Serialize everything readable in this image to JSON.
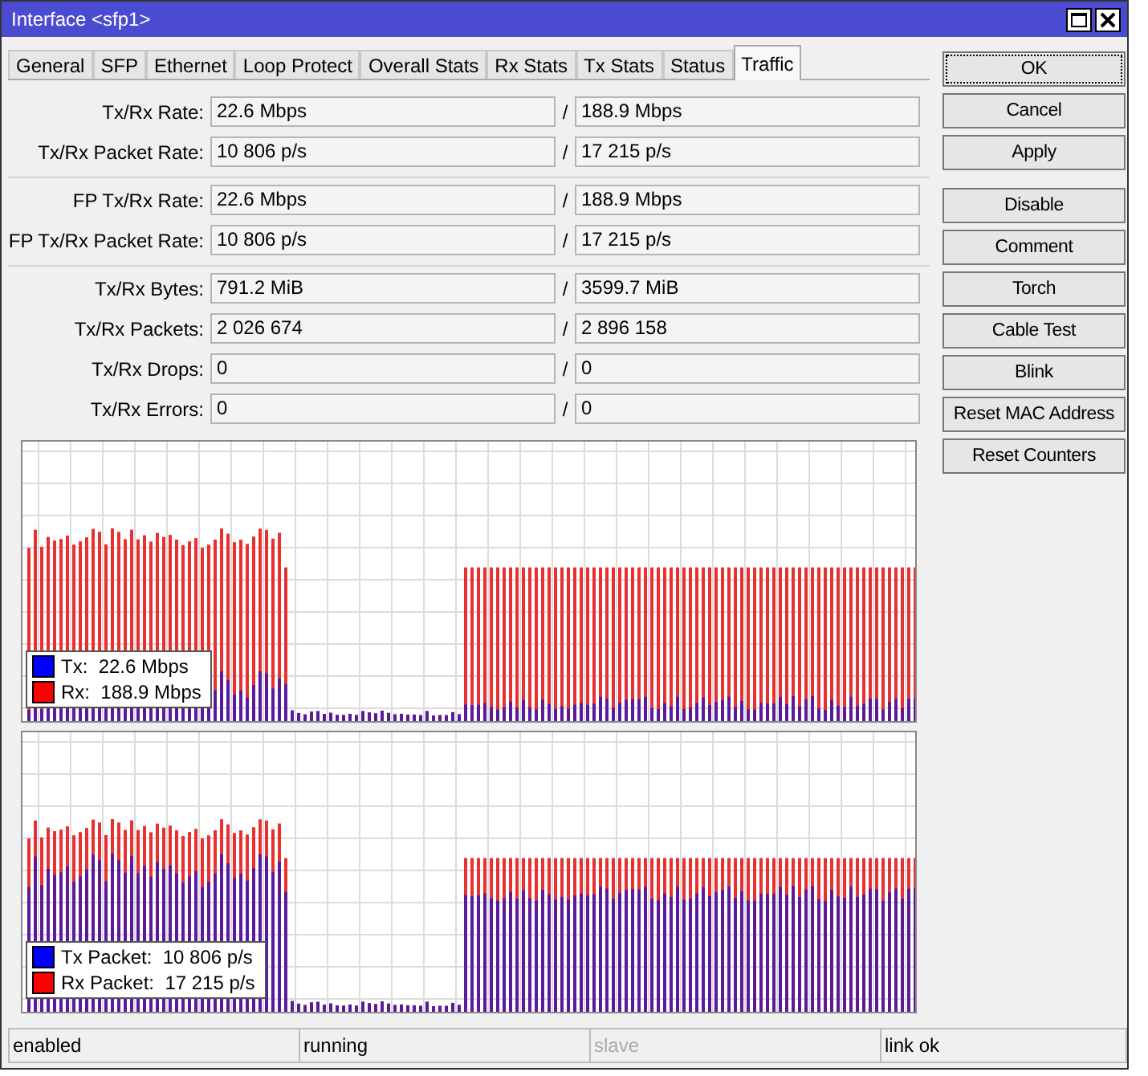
{
  "window": {
    "title": "Interface <sfp1>"
  },
  "tabs": [
    {
      "label": "General",
      "selected": false
    },
    {
      "label": "SFP",
      "selected": false
    },
    {
      "label": "Ethernet",
      "selected": false
    },
    {
      "label": "Loop Protect",
      "selected": false
    },
    {
      "label": "Overall Stats",
      "selected": false
    },
    {
      "label": "Rx Stats",
      "selected": false
    },
    {
      "label": "Tx Stats",
      "selected": false
    },
    {
      "label": "Status",
      "selected": false
    },
    {
      "label": "Traffic",
      "selected": true
    }
  ],
  "field_groups": [
    [
      {
        "label": "Tx/Rx Rate:",
        "tx": "22.6 Mbps",
        "separator": "/",
        "rx": "188.9 Mbps"
      },
      {
        "label": "Tx/Rx Packet Rate:",
        "tx": "10 806 p/s",
        "separator": "/",
        "rx": "17 215 p/s"
      }
    ],
    [
      {
        "label": "FP Tx/Rx Rate:",
        "tx": "22.6 Mbps",
        "separator": "/",
        "rx": "188.9 Mbps"
      },
      {
        "label": "FP Tx/Rx Packet Rate:",
        "tx": "10 806 p/s",
        "separator": "/",
        "rx": "17 215 p/s"
      }
    ],
    [
      {
        "label": "Tx/Rx Bytes:",
        "tx": "791.2 MiB",
        "separator": "/",
        "rx": "3599.7 MiB"
      },
      {
        "label": "Tx/Rx Packets:",
        "tx": "2 026 674",
        "separator": "/",
        "rx": "2 896 158"
      },
      {
        "label": "Tx/Rx Drops:",
        "tx": "0",
        "separator": "/",
        "rx": "0"
      },
      {
        "label": "Tx/Rx Errors:",
        "tx": "0",
        "separator": "/",
        "rx": "0"
      }
    ]
  ],
  "graphs": [
    {
      "legend": [
        {
          "label": "Tx:  22.6 Mbps",
          "color": "#0000ff"
        },
        {
          "label": "Rx:  188.9 Mbps",
          "color": "#ff0000"
        }
      ]
    },
    {
      "legend": [
        {
          "label": "Tx Packet:  10 806 p/s",
          "color": "#0000ff"
        },
        {
          "label": "Rx Packet:  17 215 p/s",
          "color": "#ff0000"
        }
      ]
    }
  ],
  "buttons": [
    {
      "label": "OK",
      "focused": true
    },
    {
      "label": "Cancel",
      "focused": false
    },
    {
      "label": "Apply",
      "focused": false
    },
    {
      "label": "Disable",
      "focused": false
    },
    {
      "label": "Comment",
      "focused": false
    },
    {
      "label": "Torch",
      "focused": false
    },
    {
      "label": "Cable Test",
      "focused": false
    },
    {
      "label": "Blink",
      "focused": false
    },
    {
      "label": "Reset MAC Address",
      "focused": false
    },
    {
      "label": "Reset Counters",
      "focused": false
    }
  ],
  "status_bar": [
    {
      "text": "enabled",
      "disabled": false
    },
    {
      "text": "running",
      "disabled": false
    },
    {
      "text": "slave",
      "disabled": true
    },
    {
      "text": "link ok",
      "disabled": false
    }
  ]
}
